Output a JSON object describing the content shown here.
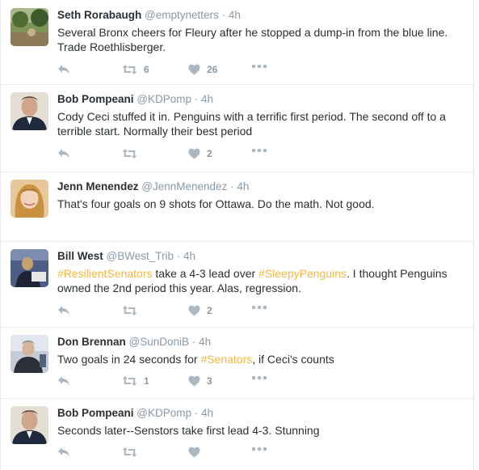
{
  "tweets": [
    {
      "name": "Seth Rorabaugh",
      "handle": "@emptynetters",
      "time": "4h",
      "text_parts": [
        "Several Bronx cheers for Fleury after he stopped a dump-in from the blue line. Trade Roethlisberger."
      ],
      "retweets": "6",
      "likes": "26",
      "avatar_colors": [
        "#6f8a4c",
        "#3d5a2a",
        "#a89a7a"
      ]
    },
    {
      "name": "Bob Pompeani",
      "handle": "@KDPomp",
      "time": "4h",
      "text_parts": [
        "Cody Ceci stuffed it in. Penguins with a terrific first period.  The second off to a terrible start. Normally their best period"
      ],
      "retweets": "",
      "likes": "2",
      "avatar_colors": [
        "#c9a891",
        "#1f2a3c",
        "#e8e2da"
      ]
    },
    {
      "name": "Jenn Menendez",
      "handle": "@JennMenendez",
      "time": "4h",
      "text_parts": [
        "That's four goals on 9 shots for Ottawa. Do the math. Not good."
      ],
      "retweets": "",
      "likes": "",
      "avatar_colors": [
        "#d9a85a",
        "#f0d2b8",
        "#b48a4a"
      ]
    },
    {
      "name": "Bill West",
      "handle": "@BWest_Trib",
      "time": "4h",
      "text_before": "",
      "hashtag1": "#ResilientSenators",
      "text_mid": " take a 4-3 lead over ",
      "hashtag2": "#SleepyPenguins",
      "text_after": ". I thought Penguins owned the 2nd period this year. Alas, regression.",
      "retweets": "",
      "likes": "2",
      "avatar_colors": [
        "#2a3552",
        "#c8a070",
        "#5b6f96"
      ]
    },
    {
      "name": "Don Brennan",
      "handle": "@SunDoniB",
      "time": "4h",
      "text_before": "Two goals in 24 seconds for ",
      "hashtag1": "#Senators",
      "text_after": ", if Ceci's counts",
      "retweets": "1",
      "likes": "3",
      "avatar_colors": [
        "#8f9bb0",
        "#2b2f3a",
        "#d2d6de"
      ]
    },
    {
      "name": "Bob Pompeani",
      "handle": "@KDPomp",
      "time": "4h",
      "text_parts": [
        "Seconds later--Senstors take first lead 4-3. Stunning"
      ],
      "retweets": "",
      "likes": "",
      "avatar_colors": [
        "#c9a891",
        "#1f2a3c",
        "#e8e2da"
      ]
    }
  ],
  "separator_dot": "·",
  "icons": {
    "reply": "reply-icon",
    "retweet": "retweet-icon",
    "like": "heart-icon",
    "more": "more-icon"
  },
  "colors": {
    "icon": "#aab8c2",
    "hashtag": "#f5b83d",
    "meta": "#8899a6",
    "text": "#292f33"
  }
}
